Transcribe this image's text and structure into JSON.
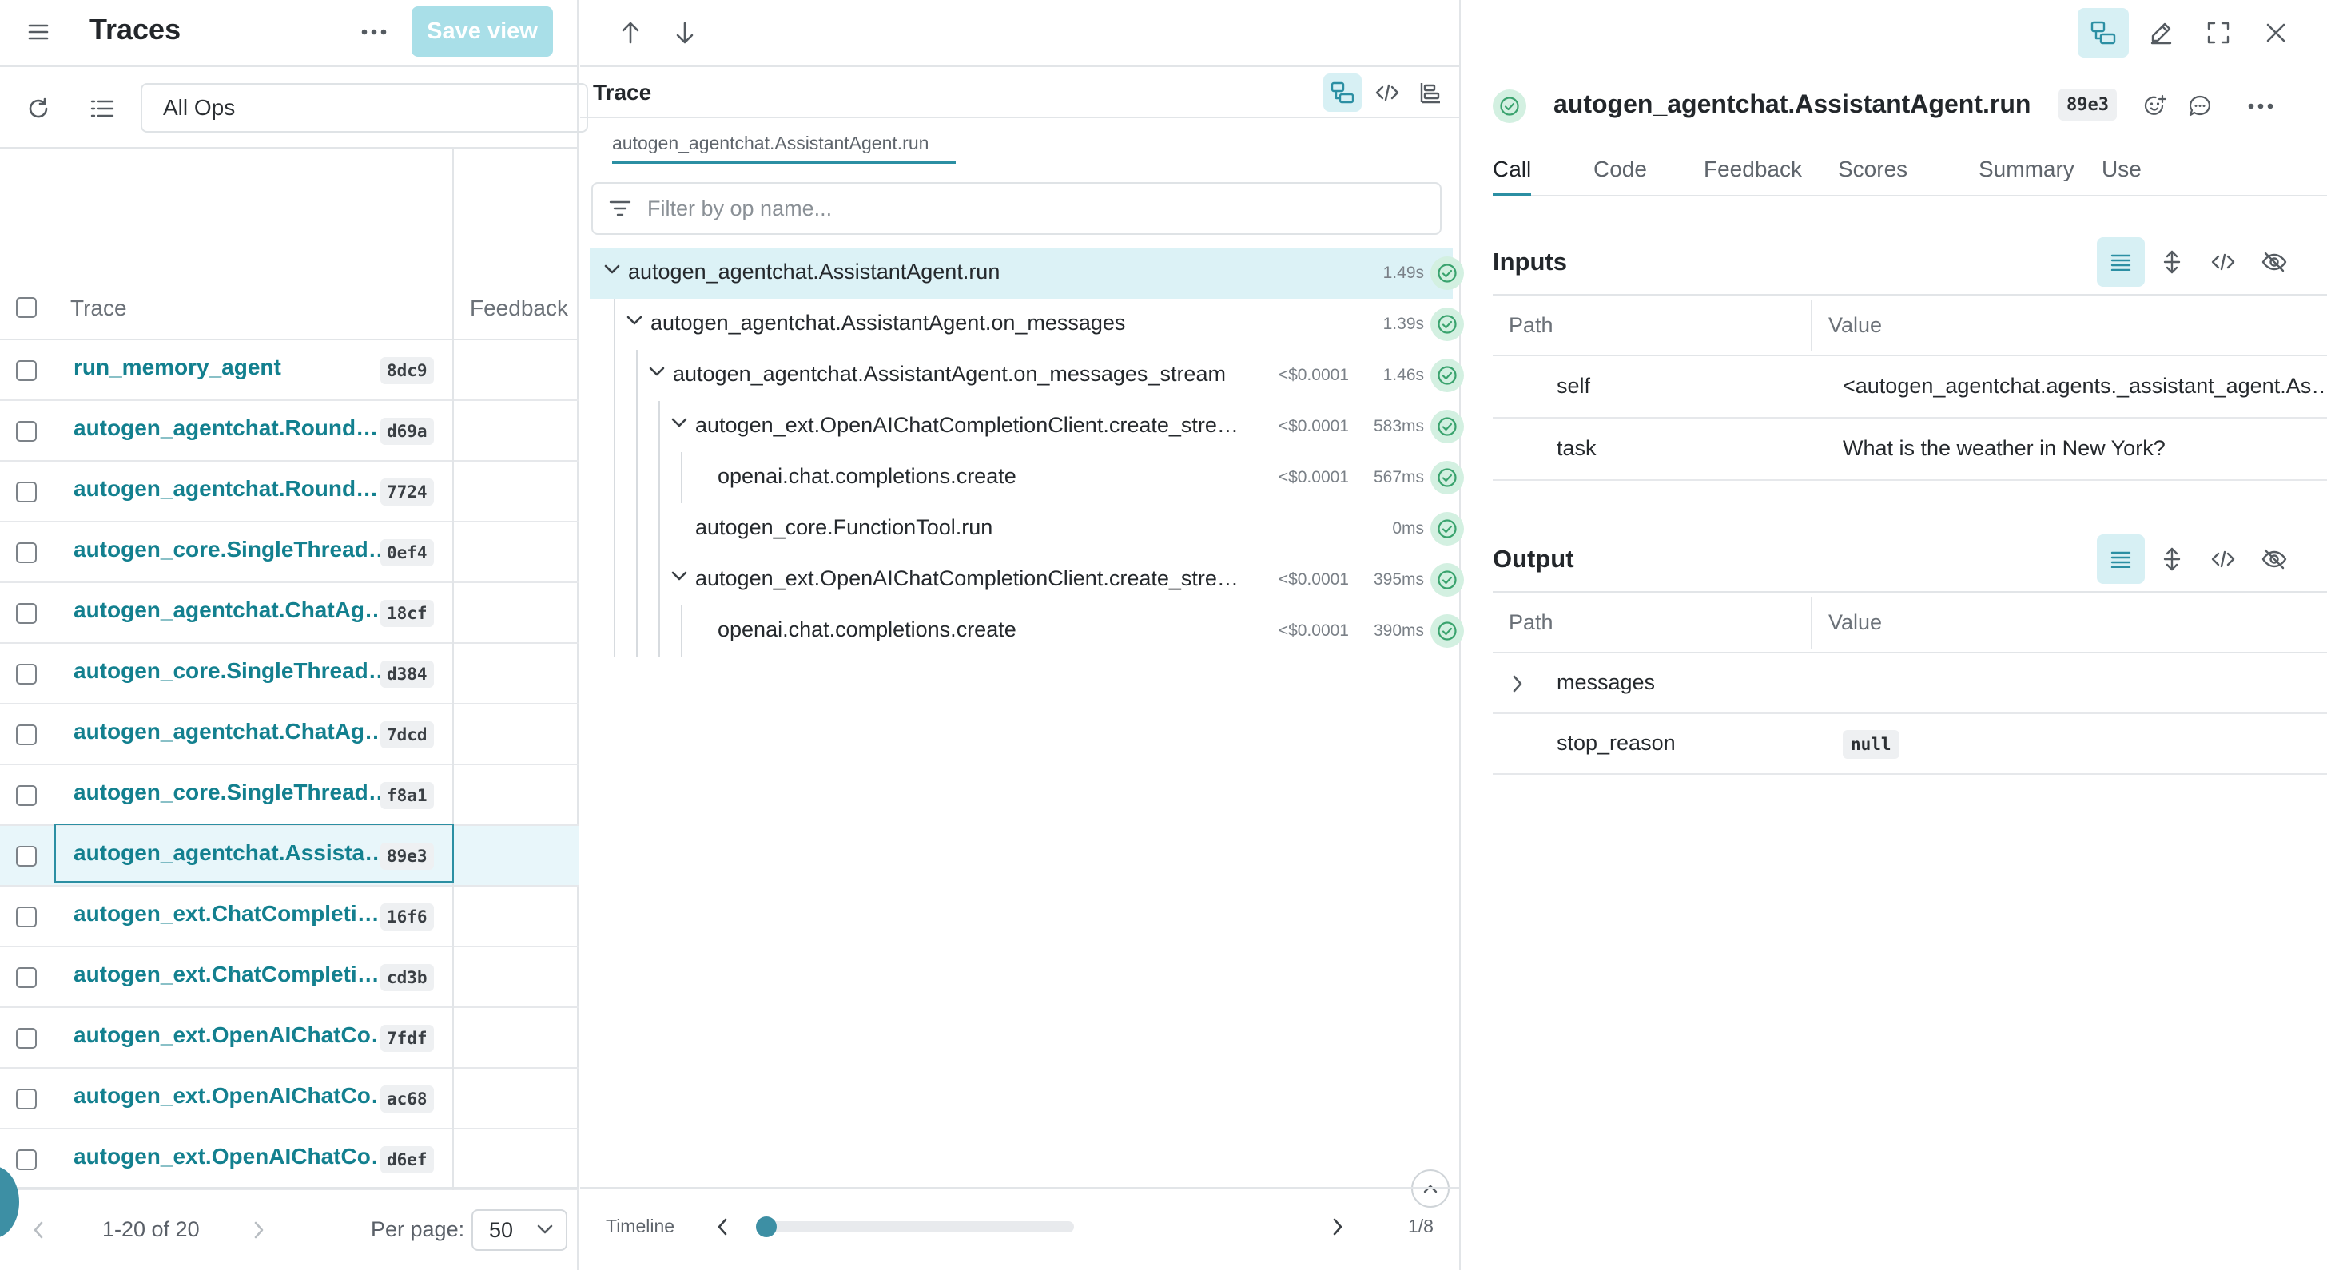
{
  "left": {
    "title": "Traces",
    "save_view_label": "Save view",
    "op_selector": "All Ops",
    "col_trace": "Trace",
    "col_feedback": "Feedback",
    "rows": [
      {
        "name": "run_memory_agent",
        "id": "8dc9"
      },
      {
        "name": "autogen_agentchat.Round…",
        "id": "d69a"
      },
      {
        "name": "autogen_agentchat.Round…",
        "id": "7724"
      },
      {
        "name": "autogen_core.SingleThread…",
        "id": "0ef4"
      },
      {
        "name": "autogen_agentchat.ChatAg…",
        "id": "18cf"
      },
      {
        "name": "autogen_core.SingleThread…",
        "id": "d384"
      },
      {
        "name": "autogen_agentchat.ChatAg…",
        "id": "7dcd"
      },
      {
        "name": "autogen_core.SingleThread…",
        "id": "f8a1"
      },
      {
        "name": "autogen_agentchat.Assista…",
        "id": "89e3"
      },
      {
        "name": "autogen_ext.ChatCompleti…",
        "id": "16f6"
      },
      {
        "name": "autogen_ext.ChatCompleti…",
        "id": "cd3b"
      },
      {
        "name": "autogen_ext.OpenAIChatCo…",
        "id": "7fdf"
      },
      {
        "name": "autogen_ext.OpenAIChatCo…",
        "id": "ac68"
      },
      {
        "name": "autogen_ext.OpenAIChatCo…",
        "id": "d6ef"
      }
    ],
    "selected_row": 8,
    "pagination": "1-20 of 20",
    "per_page_label": "Per page:",
    "per_page_value": "50"
  },
  "middle": {
    "title": "Trace",
    "breadcrumb": "autogen_agentchat.AssistantAgent.run",
    "filter_placeholder": "Filter by op name...",
    "nodes": [
      {
        "label": "autogen_agentchat.AssistantAgent.run",
        "cost": "",
        "time": "1.49s",
        "depth": 0,
        "expandable": true
      },
      {
        "label": "autogen_agentchat.AssistantAgent.on_messages",
        "cost": "",
        "time": "1.39s",
        "depth": 1,
        "expandable": true
      },
      {
        "label": "autogen_agentchat.AssistantAgent.on_messages_stream",
        "cost": "<$0.0001",
        "time": "1.46s",
        "depth": 2,
        "expandable": true
      },
      {
        "label": "autogen_ext.OpenAIChatCompletionClient.create_stre…",
        "cost": "<$0.0001",
        "time": "583ms",
        "depth": 3,
        "expandable": true
      },
      {
        "label": "openai.chat.completions.create",
        "cost": "<$0.0001",
        "time": "567ms",
        "depth": 4,
        "expandable": false
      },
      {
        "label": "autogen_core.FunctionTool.run",
        "cost": "",
        "time": "0ms",
        "depth": 3,
        "expandable": false
      },
      {
        "label": "autogen_ext.OpenAIChatCompletionClient.create_stre…",
        "cost": "<$0.0001",
        "time": "395ms",
        "depth": 3,
        "expandable": true
      },
      {
        "label": "openai.chat.completions.create",
        "cost": "<$0.0001",
        "time": "390ms",
        "depth": 4,
        "expandable": false
      }
    ],
    "timeline_label": "Timeline",
    "timeline_position": "1/8"
  },
  "right": {
    "title": "autogen_agentchat.AssistantAgent.run",
    "id_badge": "89e3",
    "tabs": [
      "Call",
      "Code",
      "Feedback",
      "Scores",
      "Summary",
      "Use"
    ],
    "active_tab": "Call",
    "inputs": {
      "title": "Inputs",
      "col_path": "Path",
      "col_value": "Value",
      "rows": [
        {
          "path": "self",
          "value": "<autogen_agentchat.agents._assistant_agent.As…"
        },
        {
          "path": "task",
          "value": "What is the weather in New York?"
        }
      ]
    },
    "output": {
      "title": "Output",
      "col_path": "Path",
      "col_value": "Value",
      "rows": [
        {
          "path": "messages",
          "value": ""
        },
        {
          "path": "stop_reason",
          "value": "null"
        }
      ]
    }
  },
  "colors": {
    "accent": "#2b8fa3",
    "link": "#13808f",
    "active_bg": "#d7f0f4",
    "success": "#3aa36e"
  }
}
